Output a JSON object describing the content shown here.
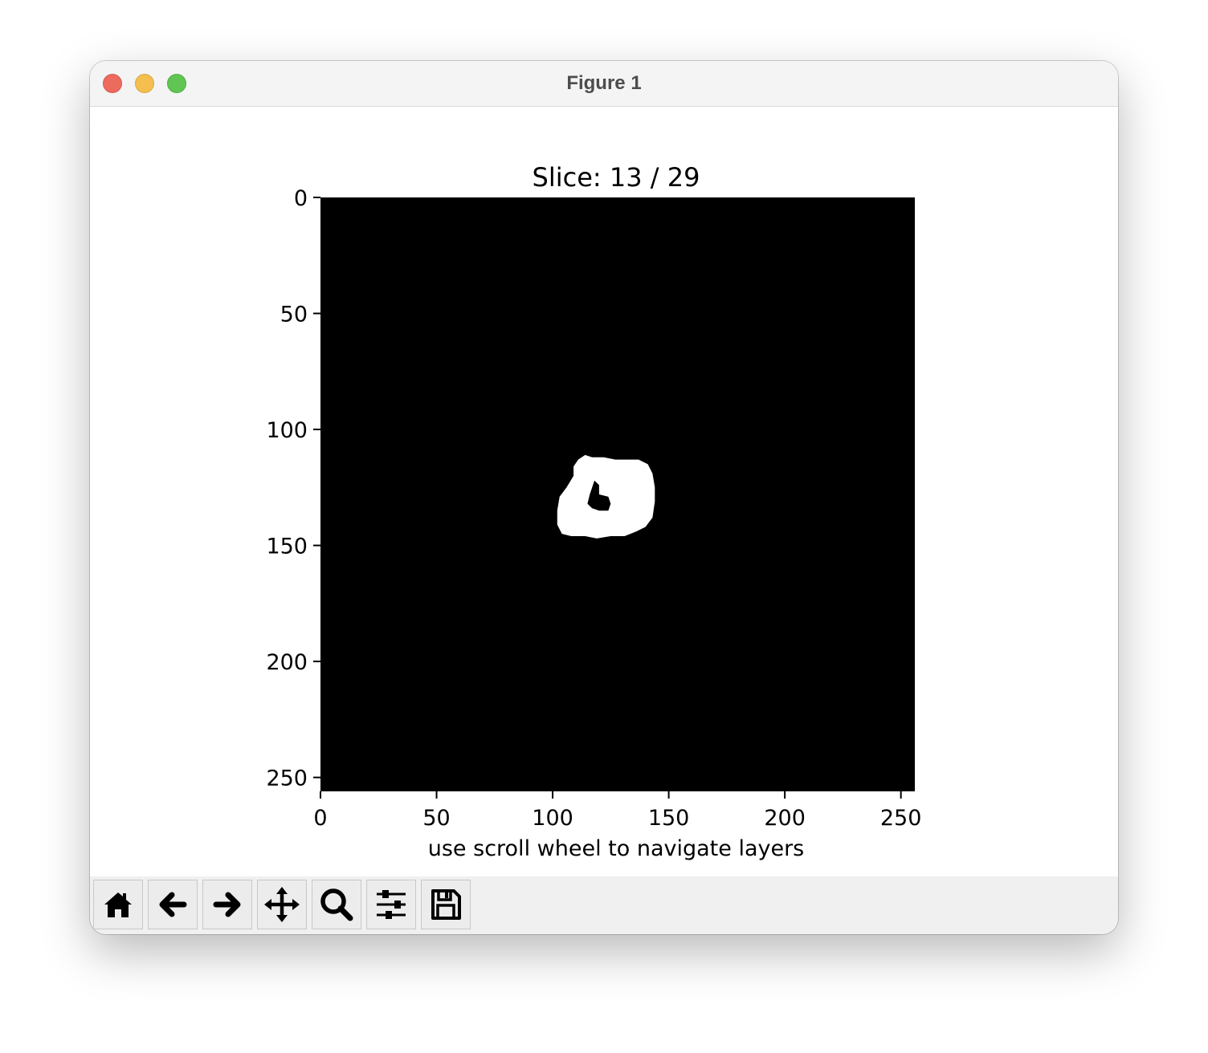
{
  "window": {
    "title": "Figure 1"
  },
  "figure": {
    "title": "Slice: 13 / 29",
    "xlabel": "use scroll wheel to navigate layers",
    "x_ticks": [
      "0",
      "50",
      "100",
      "150",
      "200",
      "250"
    ],
    "y_ticks": [
      "0",
      "50",
      "100",
      "150",
      "200",
      "250"
    ]
  },
  "chart_data": {
    "type": "heatmap",
    "title": "Slice: 13 / 29",
    "xlabel": "use scroll wheel to navigate layers",
    "ylabel": "",
    "image_size": [
      256,
      256
    ],
    "xlim": [
      0,
      256
    ],
    "ylim": [
      256,
      0
    ],
    "colormap": "gray",
    "slice_index": 13,
    "slice_count": 29,
    "mask_outline": [
      [
        111,
        113
      ],
      [
        114,
        111
      ],
      [
        117,
        112
      ],
      [
        122,
        112
      ],
      [
        127,
        113
      ],
      [
        132,
        113
      ],
      [
        137,
        113
      ],
      [
        141,
        115
      ],
      [
        143,
        119
      ],
      [
        144,
        125
      ],
      [
        144,
        131
      ],
      [
        143,
        138
      ],
      [
        140,
        142
      ],
      [
        136,
        144
      ],
      [
        131,
        146
      ],
      [
        125,
        146
      ],
      [
        119,
        147
      ],
      [
        114,
        146
      ],
      [
        108,
        146
      ],
      [
        104,
        145
      ],
      [
        102,
        141
      ],
      [
        102,
        135
      ],
      [
        103,
        129
      ],
      [
        106,
        125
      ],
      [
        109,
        120
      ],
      [
        109,
        116
      ]
    ],
    "hole_outline": [
      [
        118,
        122
      ],
      [
        120,
        124
      ],
      [
        120,
        128
      ],
      [
        124,
        129
      ],
      [
        125,
        132
      ],
      [
        124,
        135
      ],
      [
        120,
        135
      ],
      [
        117,
        134
      ],
      [
        115,
        132
      ],
      [
        116,
        128
      ]
    ]
  },
  "toolbar": {
    "buttons": [
      {
        "name": "home-button",
        "icon": "home-icon"
      },
      {
        "name": "back-button",
        "icon": "arrow-left-icon"
      },
      {
        "name": "forward-button",
        "icon": "arrow-right-icon"
      },
      {
        "name": "pan-button",
        "icon": "move-icon"
      },
      {
        "name": "zoom-button",
        "icon": "magnifier-icon"
      },
      {
        "name": "configure-subplots-button",
        "icon": "sliders-icon"
      },
      {
        "name": "save-button",
        "icon": "floppy-disk-icon"
      }
    ]
  },
  "colors": {
    "image_background": "#000000",
    "mask": "#ffffff"
  }
}
